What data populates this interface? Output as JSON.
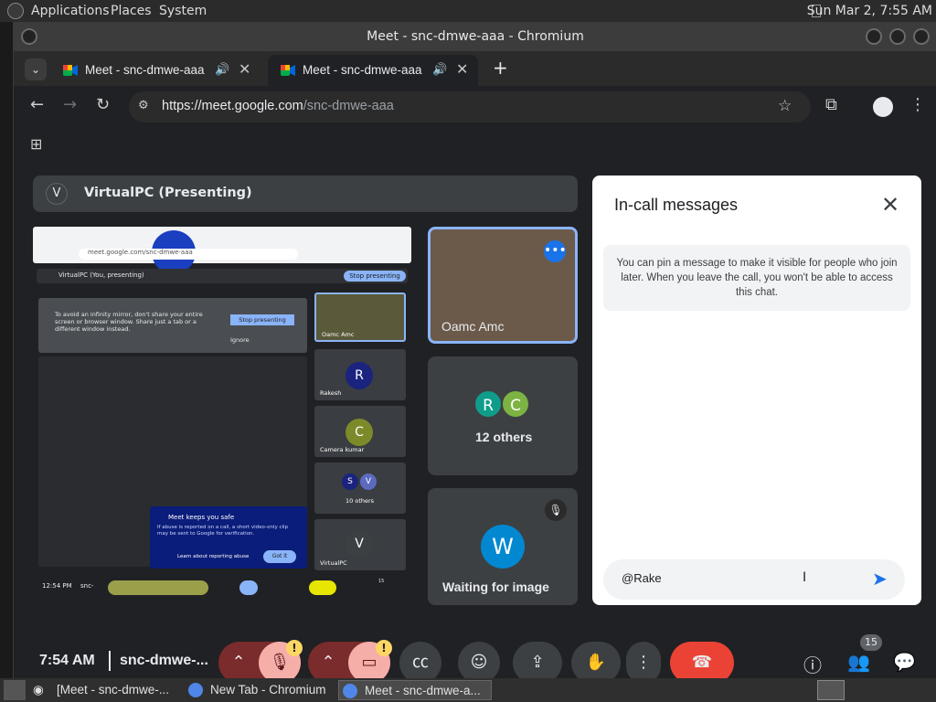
{
  "panel": {
    "menus": [
      "Applications",
      "Places",
      "System"
    ],
    "clock": "Sun Mar  2,  7:55 AM"
  },
  "window": {
    "title": "Meet - snc-dmwe-aaa - Chromium"
  },
  "tabs": [
    {
      "title": "Meet - snc-dmwe-aaa",
      "active": false
    },
    {
      "title": "Meet - snc-dmwe-aaa",
      "active": true
    }
  ],
  "new_tab_label": "+",
  "address": {
    "host": "https://meet.google.com",
    "path": "/snc-dmwe-aaa"
  },
  "meet": {
    "presenting_label": "VirtualPC (Presenting)",
    "presenting_initial": "V",
    "shared_screen": {
      "url": "meet.google.com/snc-dmwe-aaa",
      "present_label": "VirtualPC (You, presenting)",
      "stop_button": "Stop presenting",
      "warning_text": "To avoid an infinity mirror, don't share your entire screen or browser window. Share just a tab or a different window instead.",
      "warning_stop": "Stop presenting",
      "warning_ignore": "Ignore",
      "safe_title": "Meet keeps you safe",
      "safe_text": "If abuse is reported on a call, a short video-only clip may be sent to Google for verification.",
      "safe_link": "Learn about reporting abuse",
      "safe_button": "Got it",
      "tiles": [
        "Oamc Amc",
        "Rakesh",
        "Camera kumar",
        "10 others",
        "VirtualPC"
      ],
      "tile_initials": [
        "R",
        "C",
        "S",
        "V",
        "V"
      ],
      "bottom_time": "12:54 PM",
      "bottom_code": "snc-",
      "bottom_count": "15"
    },
    "tiles": [
      {
        "name": "Oamc Amc"
      },
      {
        "name": "12 others",
        "initials": [
          "R",
          "C"
        ]
      },
      {
        "name": "Waiting for image",
        "initial": "W"
      }
    ],
    "time": "7:54 AM",
    "meeting_code": "snc-dmwe-...",
    "participants_badge": "15"
  },
  "chat": {
    "title": "In-call messages",
    "info": "You can pin a message to make it visible for people who join later. When you leave the call, you won't be able to access this chat.",
    "input_value": "@Rake"
  },
  "taskbar": {
    "items": [
      "[Meet - snc-dmwe-...",
      "New Tab - Chromium",
      "Meet - snc-dmwe-a..."
    ]
  },
  "colors": {
    "accent": "#1a73e8",
    "end_call": "#ea4335",
    "muted": "#f6aea9"
  }
}
